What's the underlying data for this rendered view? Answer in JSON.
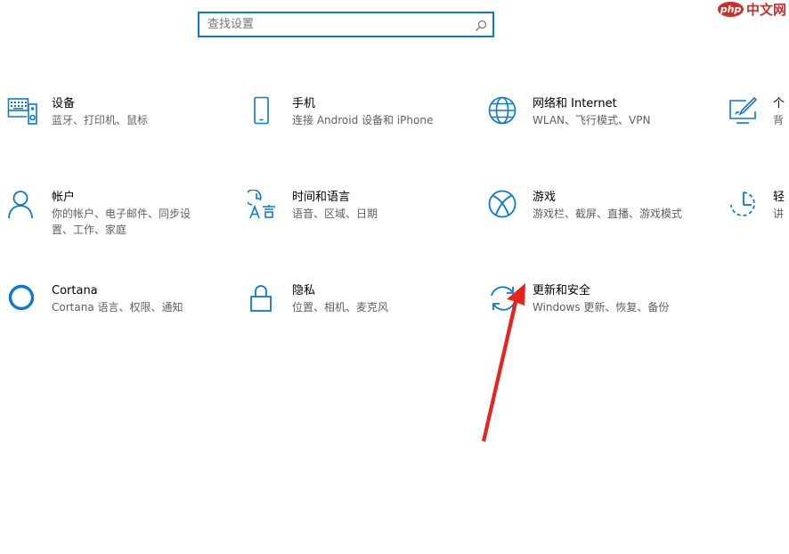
{
  "search": {
    "placeholder": "查找设置",
    "icon": "search-icon"
  },
  "watermark": {
    "badge": "php",
    "text": "中文网"
  },
  "tiles": [
    {
      "id": "devices",
      "icon": "keyboard-speaker-icon",
      "title": "设备",
      "desc": "蓝牙、打印机、鼠标"
    },
    {
      "id": "phone",
      "icon": "phone-icon",
      "title": "手机",
      "desc": "连接 Android 设备和 iPhone"
    },
    {
      "id": "network",
      "icon": "globe-icon",
      "title": "网络和 Internet",
      "desc": "WLAN、飞行模式、VPN"
    },
    {
      "id": "personalization",
      "icon": "paint-display-icon",
      "title": "个",
      "desc": "背"
    },
    {
      "id": "accounts",
      "icon": "person-icon",
      "title": "帐户",
      "desc": "你的帐户、电子邮件、同步设置、工作、家庭",
      "desc_line1": "你的帐户、电子邮件、同步设",
      "desc_line2": "置、工作、家庭"
    },
    {
      "id": "time-language",
      "icon": "time-language-icon",
      "title": "时间和语言",
      "desc": "语音、区域、日期"
    },
    {
      "id": "gaming",
      "icon": "xbox-icon",
      "title": "游戏",
      "desc": "游戏栏、截屏、直播、游戏模式"
    },
    {
      "id": "ease-of-access",
      "icon": "ease-of-access-icon",
      "title": "轻",
      "desc": "讲"
    },
    {
      "id": "cortana",
      "icon": "cortana-circle-icon",
      "title": "Cortana",
      "desc": "Cortana 语言、权限、通知"
    },
    {
      "id": "privacy",
      "icon": "lock-icon",
      "title": "隐私",
      "desc": "位置、相机、麦克风"
    },
    {
      "id": "update-security",
      "icon": "sync-arrows-icon",
      "title": "更新和安全",
      "desc": "Windows 更新、恢复、备份"
    }
  ],
  "colors": {
    "accent": "#0a78d7",
    "annotation_arrow": "#e8231e",
    "watermark": "#c9302c"
  }
}
